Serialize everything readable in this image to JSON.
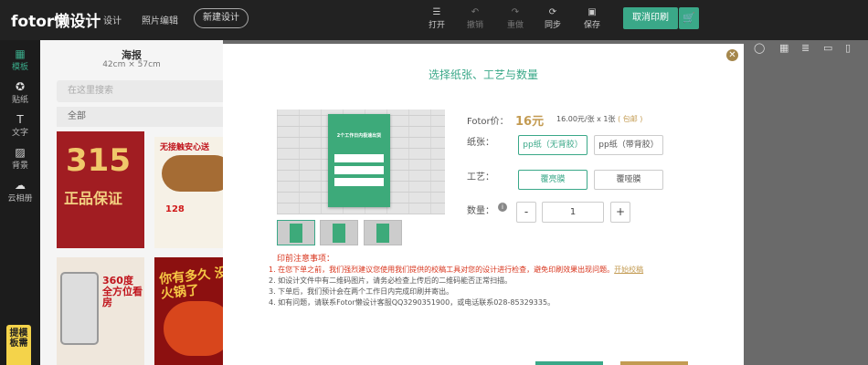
{
  "header": {
    "logo": "fotor懒设计",
    "menu_design": "设计",
    "menu_photo_edit": "照片编辑",
    "new_design_label": "新建设计",
    "tools": [
      {
        "label": "打开",
        "icon": "menu-icon"
      },
      {
        "label": "撤销",
        "icon": "undo-icon"
      },
      {
        "label": "重做",
        "icon": "redo-icon"
      },
      {
        "label": "同步",
        "icon": "sync-icon"
      },
      {
        "label": "保存",
        "icon": "save-icon"
      }
    ],
    "print_label": "取消印刷"
  },
  "sidebar": {
    "items": [
      {
        "label": "模板",
        "icon": "template-icon"
      },
      {
        "label": "贴纸",
        "icon": "sticker-icon"
      },
      {
        "label": "文字",
        "icon": "text-icon"
      },
      {
        "label": "背景",
        "icon": "background-icon"
      },
      {
        "label": "云相册",
        "icon": "cloud-album-icon"
      }
    ],
    "promo": "提模板需"
  },
  "panel": {
    "title": "海报",
    "size": "42cm × 57cm",
    "search_placeholder": "在这里搜索",
    "filter": "全部",
    "thumbs": {
      "t1_big": "315",
      "t1_mid": "正品保证",
      "t2_head": "无接触安心送",
      "t2_price": "128",
      "t3_head": "360度 全方位看房",
      "t4_head": "你有多久 没吃火锅了"
    }
  },
  "modal": {
    "title": "选择纸张、工艺与数量",
    "price_label": "Fotor价：",
    "price": "16元",
    "price_note": "16.00元/张 x 1张",
    "price_tag": "( 包邮 )",
    "paper_label": "纸张：",
    "paper_options": [
      "pp纸（无背胶）",
      "pp纸（带背胶）"
    ],
    "craft_label": "工艺：",
    "craft_options": [
      "覆亮膜",
      "覆哑膜"
    ],
    "qty_label": "数量：",
    "qty_minus": "-",
    "qty_value": "1",
    "qty_plus": "+",
    "poster_text": "2个工作日内极速出货",
    "notes_title": "印前注意事项：",
    "notes": [
      "1. 在您下单之前，我们强烈建议您使用我们提供的校稿工具对您的设计进行检查，避免印刷效果出现问题。",
      "2. 如设计文件中有二维码图片，请务必检查上传后的二维码能否正常扫描。",
      "3. 下单后，我们预计会在两个工作日内完成印刷并寄出。",
      "4. 如有问题，请联系Fotor懒设计客服QQ3290351900，或电话联系028-85329335。"
    ],
    "note1_link": "开始校稿"
  }
}
